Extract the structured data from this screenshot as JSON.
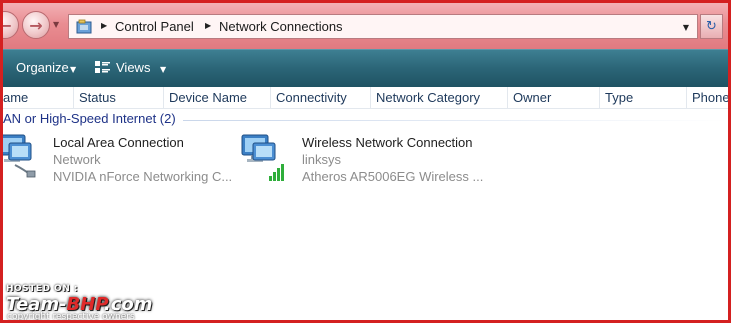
{
  "address_bar": {
    "breadcrumbs": [
      "Control Panel",
      "Network Connections"
    ]
  },
  "toolbar": {
    "organize_label": "Organize",
    "views_label": "Views"
  },
  "columns": [
    "ame",
    "Status",
    "Device Name",
    "Connectivity",
    "Network Category",
    "Owner",
    "Type",
    "Phone"
  ],
  "group": {
    "label": "AN or High-Speed Internet (2)"
  },
  "connections": [
    {
      "name": "Local Area Connection",
      "status": "Network",
      "device": "NVIDIA nForce Networking C...",
      "icon": "network-cable-icon"
    },
    {
      "name": "Wireless Network Connection",
      "status": "linksys",
      "device": "Atheros AR5006EG Wireless ...",
      "icon": "wireless-network-icon"
    }
  ],
  "watermark": {
    "hosted": "HOSTED ON :",
    "logo_main": "Team-",
    "logo_accent": "BHP",
    "logo_suffix": ".com",
    "copyright": "copyright respective owners"
  },
  "colors": {
    "border": "#d42020",
    "address_bar": "#e98d92",
    "command_bar": "#2b6577",
    "group_header": "#1e3287",
    "column_text": "#1e395b"
  }
}
